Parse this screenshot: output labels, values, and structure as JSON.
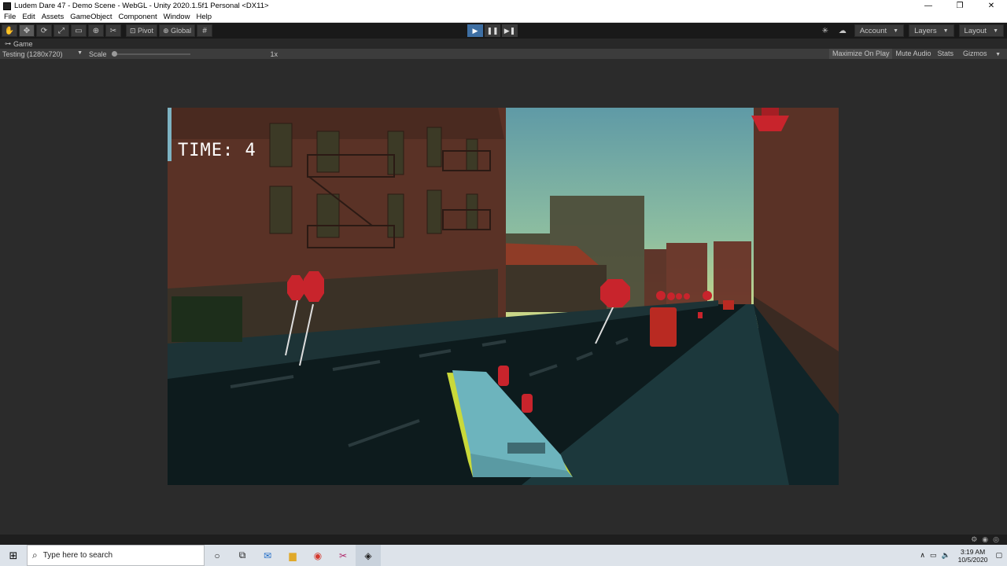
{
  "window": {
    "title": "Ludem Dare 47 - Demo Scene - WebGL - Unity 2020.1.5f1 Personal <DX11>",
    "controls": [
      "—",
      "❐",
      "✕"
    ]
  },
  "menu": [
    "File",
    "Edit",
    "Assets",
    "GameObject",
    "Component",
    "Window",
    "Help"
  ],
  "toolbar": {
    "tools": [
      {
        "name": "hand-tool",
        "glyph": "✋"
      },
      {
        "name": "move-tool",
        "glyph": "✥"
      },
      {
        "name": "rotate-tool",
        "glyph": "⟳"
      },
      {
        "name": "scale-tool",
        "glyph": "⤢"
      },
      {
        "name": "rect-tool",
        "glyph": "▭"
      },
      {
        "name": "transform-tool",
        "glyph": "⊕"
      },
      {
        "name": "custom-tool",
        "glyph": "✂"
      }
    ],
    "pivot_label": "Pivot",
    "global_label": "Global",
    "play": "▶",
    "pause": "❚❚",
    "step": "▶❚",
    "account_label": "Account",
    "layers_label": "Layers",
    "layout_label": "Layout"
  },
  "tab": {
    "label": "Game"
  },
  "gamebar": {
    "resolution": "Testing (1280x720)",
    "scale_label": "Scale",
    "scale_value": "1x",
    "scale_level": 0.0,
    "maximize": "Maximize On Play",
    "mute": "Mute Audio",
    "stats": "Stats",
    "gizmos": "Gizmos"
  },
  "hud": {
    "time": "TIME: 4"
  },
  "taskbar": {
    "search_placeholder": "Type here to search",
    "time": "3:19 AM",
    "date": "10/5/2020"
  },
  "colors": {
    "sky_top": "#6ea6b0",
    "sky_bottom": "#c7d88a",
    "building": "#5a3226",
    "road": "#0e1b1e",
    "sidewalk": "#1f3a3e",
    "sign": "#c8242c",
    "car": "#6db4bd",
    "car_trim": "#c9d93a"
  }
}
